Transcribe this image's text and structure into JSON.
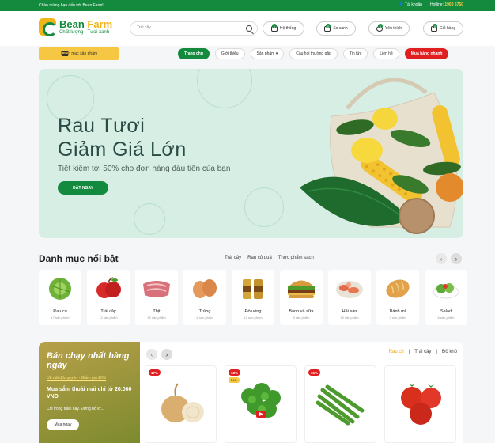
{
  "topbar": {
    "welcome": "Chào mừng bạn đến với Bean Farm!",
    "account": "Tài khoản",
    "hotline_label": "Hotline:",
    "hotline_number": "1900 6750"
  },
  "header": {
    "logo_title_a": "Bean",
    "logo_title_b": "Farm",
    "logo_tagline": "Chất lượng - Tươi xanh",
    "search_placeholder": "Trái cây",
    "buttons": [
      {
        "label": "Hệ thống",
        "badge": "1"
      },
      {
        "label": "So sánh",
        "badge": "0"
      },
      {
        "label": "Yêu thích",
        "badge": "0"
      },
      {
        "label": "Giỏ hàng",
        "badge": "0"
      }
    ]
  },
  "nav": {
    "category_button": "Danh mục sản phẩm",
    "items": [
      "Trang chủ",
      "Giới thiệu",
      "Sản phẩm ▾",
      "Câu hỏi thường gặp",
      "Tin tức",
      "Liên hệ",
      "Mua hàng nhanh"
    ]
  },
  "hero": {
    "title_line1": "Rau Tươi",
    "title_line2": "Giảm Giá Lớn",
    "subtitle": "Tiết kiệm tới 50% cho đơn hàng đầu tiên của bạn",
    "cta": "ĐẶT NGAY"
  },
  "featured": {
    "title": "Danh mục nổi bật",
    "tabs": [
      "Trái cây",
      "Rau củ quả",
      "Thực phẩm sạch"
    ],
    "categories": [
      {
        "name": "Rau củ",
        "count": "17 sản phẩm",
        "icon": "cabbage"
      },
      {
        "name": "Trái cây",
        "count": "12 sản phẩm",
        "icon": "apple"
      },
      {
        "name": "Thịt",
        "count": "10 sản phẩm",
        "icon": "meat"
      },
      {
        "name": "Trứng",
        "count": "6 sản phẩm",
        "icon": "eggs"
      },
      {
        "name": "Đồ uống",
        "count": "17 sản phẩm",
        "icon": "drinks"
      },
      {
        "name": "Bánh và sữa",
        "count": "8 sản phẩm",
        "icon": "burger"
      },
      {
        "name": "Hải sản",
        "count": "10 sản phẩm",
        "icon": "seafood"
      },
      {
        "name": "Bánh mì",
        "count": "3 sản phẩm",
        "icon": "bread"
      },
      {
        "name": "Salad",
        "count": "6 sản phẩm",
        "icon": "salad"
      }
    ]
  },
  "bestseller": {
    "title": "Bán chạy nhất hàng ngày",
    "link": "Ưu đãi độc quyền - Giảm giá 20%",
    "subtitle": "Mua sắm thoải mái chỉ từ 20.000 VNĐ",
    "note": "Chỉ trong tuần này. Đừng bỏ lỡ...",
    "cta": "Mua ngay",
    "tabs": [
      "Rau củ",
      "Trái cây",
      "Đồ khô"
    ],
    "products": [
      {
        "discount": "17%",
        "icon": "onion"
      },
      {
        "discount": "18%",
        "extra_tag": "FAS",
        "icon": "parsley"
      },
      {
        "discount": "15%",
        "icon": "green-beans"
      },
      {
        "discount": "",
        "icon": "tomato"
      }
    ]
  },
  "colors": {
    "brand_green": "#138a3d",
    "brand_yellow": "#f1b41a",
    "promo_red": "#e02020"
  }
}
